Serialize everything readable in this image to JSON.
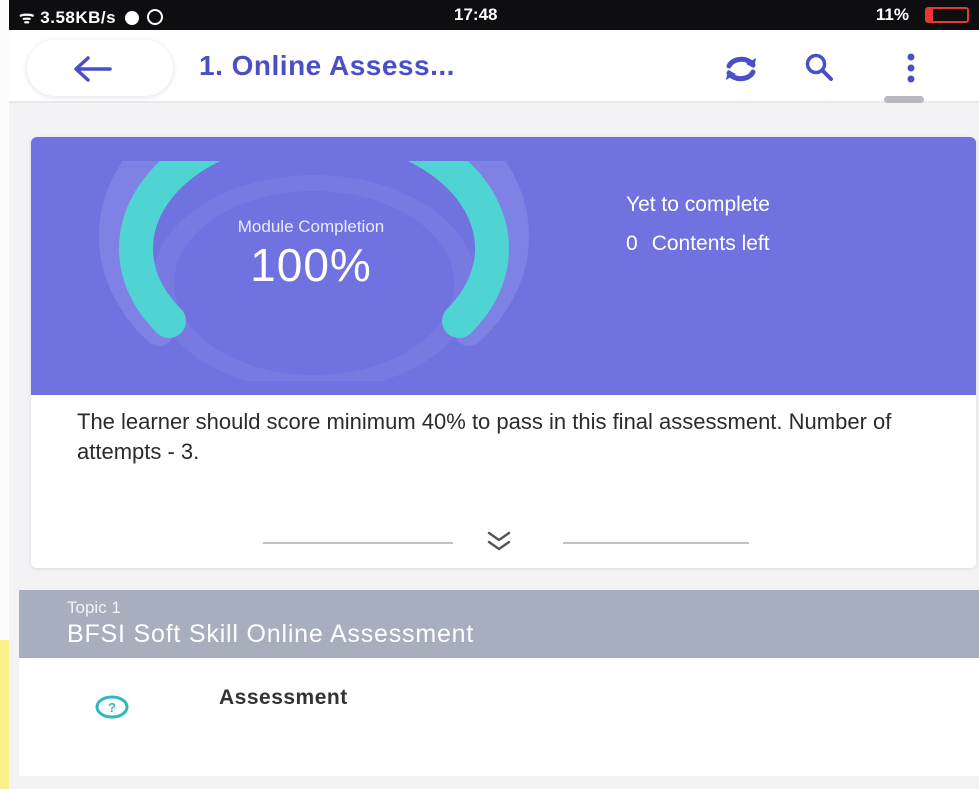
{
  "status_bar": {
    "network_speed": "3.58KB/s",
    "time": "17:48",
    "battery": "11%"
  },
  "app_bar": {
    "title": "1. Online Assess..."
  },
  "module": {
    "completion_label": "Module Completion",
    "completion_value": "100%",
    "completion_percent": 100,
    "yet_to_complete_label": "Yet to complete",
    "contents_left_count": "0",
    "contents_left_label": "Contents left",
    "description": "The learner should score minimum 40% to pass in this final assessment. Number of attempts - 3.",
    "accent_color": "#6f72df",
    "gauge_color": "#4fd3d3"
  },
  "topic": {
    "label": "Topic 1",
    "title": "BFSI Soft Skill Online Assessment",
    "items": [
      {
        "label": "Assessment",
        "icon": "help-circle-icon"
      }
    ]
  }
}
